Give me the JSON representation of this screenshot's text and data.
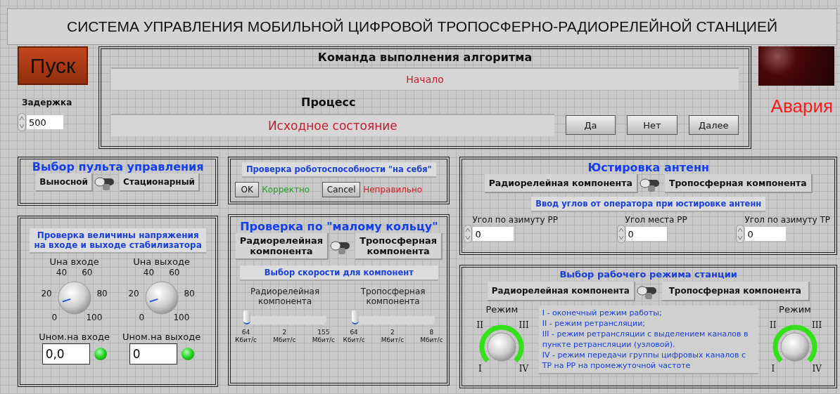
{
  "title": "СИСТЕМА УПРАВЛЕНИЯ МОБИЛЬНОЙ ЦИФРОВОЙ ТРОПОСФЕРНО-РАДИОРЕЛЕЙНОЙ СТАНЦИЕЙ",
  "start_button": "Пуск",
  "delay": {
    "label": "Задержка",
    "value": "500"
  },
  "command_panel": {
    "command_label": "Команда выполнения алгоритма",
    "command_value": "Начало",
    "process_label": "Процесс",
    "process_value": "Исходное состояние",
    "buttons": [
      "Да",
      "Нет",
      "Далее"
    ]
  },
  "alarm": {
    "on": false,
    "label": "Авария"
  },
  "console_select": {
    "title": "Выбор пульта управления",
    "left": "Выносной",
    "right": "Стационарный",
    "on": false
  },
  "self_check": {
    "title": "Проверка роботоспособности \"на себя\"",
    "ok_button": "OK",
    "ok_result": "Корректно",
    "cancel_button": "Cancel",
    "cancel_result": "Неправильно"
  },
  "antenna": {
    "title": "Юстировка антенн",
    "left": "Радиорелейная компонента",
    "right": "Тропосферная компонента",
    "on": false,
    "subtitle": "Ввод углов от оператора при юстировке антенн",
    "angles": [
      {
        "label": "Угол по азимуту РР",
        "value": "0"
      },
      {
        "label": "Угол места РР",
        "value": "0"
      },
      {
        "label": "Угол по азимуту ТР",
        "value": "0"
      }
    ]
  },
  "voltage": {
    "title": "Проверка величины напряжения\nна входе и выходе стабилизатора",
    "dials": [
      {
        "label": "Uна входе",
        "ticks": [
          "0",
          "20",
          "40",
          "60",
          "80",
          "100"
        ],
        "nominal_label": "Uном.на входе",
        "nominal_value": "0,0",
        "ok": true
      },
      {
        "label": "Uна выходе",
        "ticks": [
          "0",
          "20",
          "40",
          "60",
          "80",
          "100"
        ],
        "nominal_label": "Uном.на выходе",
        "nominal_value": "0",
        "ok": true
      }
    ]
  },
  "small_ring": {
    "title": "Проверка по \"малому кольцу\"",
    "left": "Радиорелейная\nкомпонента",
    "right": "Тропосферная\nкомпонента",
    "on": false,
    "speed_title": "Выбор скорости для компонент",
    "sliders": [
      {
        "label": "Радиорелейная\nкомпонента",
        "level": 0,
        "ticks": [
          {
            "value": "64",
            "unit": "Кбит/с"
          },
          {
            "value": "2",
            "unit": "Мбит/с"
          },
          {
            "value": "155",
            "unit": "Мбит/с"
          }
        ]
      },
      {
        "label": "Тропосферная\nкомпонента",
        "level": 0,
        "ticks": [
          {
            "value": "64",
            "unit": "Кбит/с"
          },
          {
            "value": "2",
            "unit": "Мбит/с"
          },
          {
            "value": "8",
            "unit": "Мбит/с"
          }
        ]
      }
    ]
  },
  "mode": {
    "title": "Выбор рабочего режима станции",
    "left": "Радиорелейная компонента",
    "right": "Тропосферная компонента",
    "on": false,
    "dials": [
      {
        "label": "Режим",
        "ticks": [
          "II",
          "III",
          "I",
          "IV"
        ]
      },
      {
        "label": "Режим",
        "ticks": [
          "II",
          "III",
          "I",
          "IV"
        ]
      }
    ],
    "legend": [
      "I - оконечный режим работы;",
      "II - режим ретрансляции;",
      "III - режим ретрансляции с выделением каналов в пункте ретрансляции (узловой).",
      "IV - режим передачи группы цифровых каналов с ТР на РР на промежуточной частоте"
    ]
  }
}
